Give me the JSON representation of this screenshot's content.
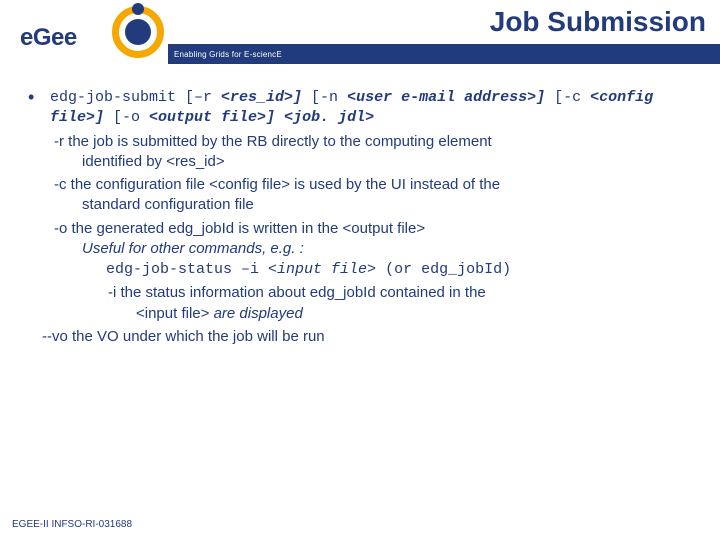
{
  "header": {
    "title": "Job Submission",
    "tagline": "Enabling Grids for E-sciencE",
    "logo_text": "eGee"
  },
  "cmd": {
    "part1": "edg-job-submit [–r ",
    "arg1": "<res_id>]",
    "part2": " [-n ",
    "arg2": "<user e-mail address>]",
    "part3": " [-c ",
    "arg3": "<config file>]",
    "part4": " [-o ",
    "arg4": "<output file>]",
    "arg5": "<job. jdl>"
  },
  "options": {
    "r1": "-r the job is submitted by the RB directly to the computing element",
    "r2": "identified by <res_id>",
    "c1": "-c the configuration file <config file> is used by the UI instead of the",
    "c2": "standard configuration file",
    "o1": "-o the generated edg_jobId is written in the <output file>",
    "o2": "Useful for other commands, e.g. :",
    "o3a": "edg-job-status –i ",
    "o3b": "<input file>",
    "o3c": " (or edg_jobId)",
    "i1": "-i the status information about edg_jobId contained in the",
    "i2a": "<input file> ",
    "i2b": "are displayed",
    "vo": "--vo the VO under which the job will be run"
  },
  "footer": "EGEE-II INFSO-RI-031688"
}
